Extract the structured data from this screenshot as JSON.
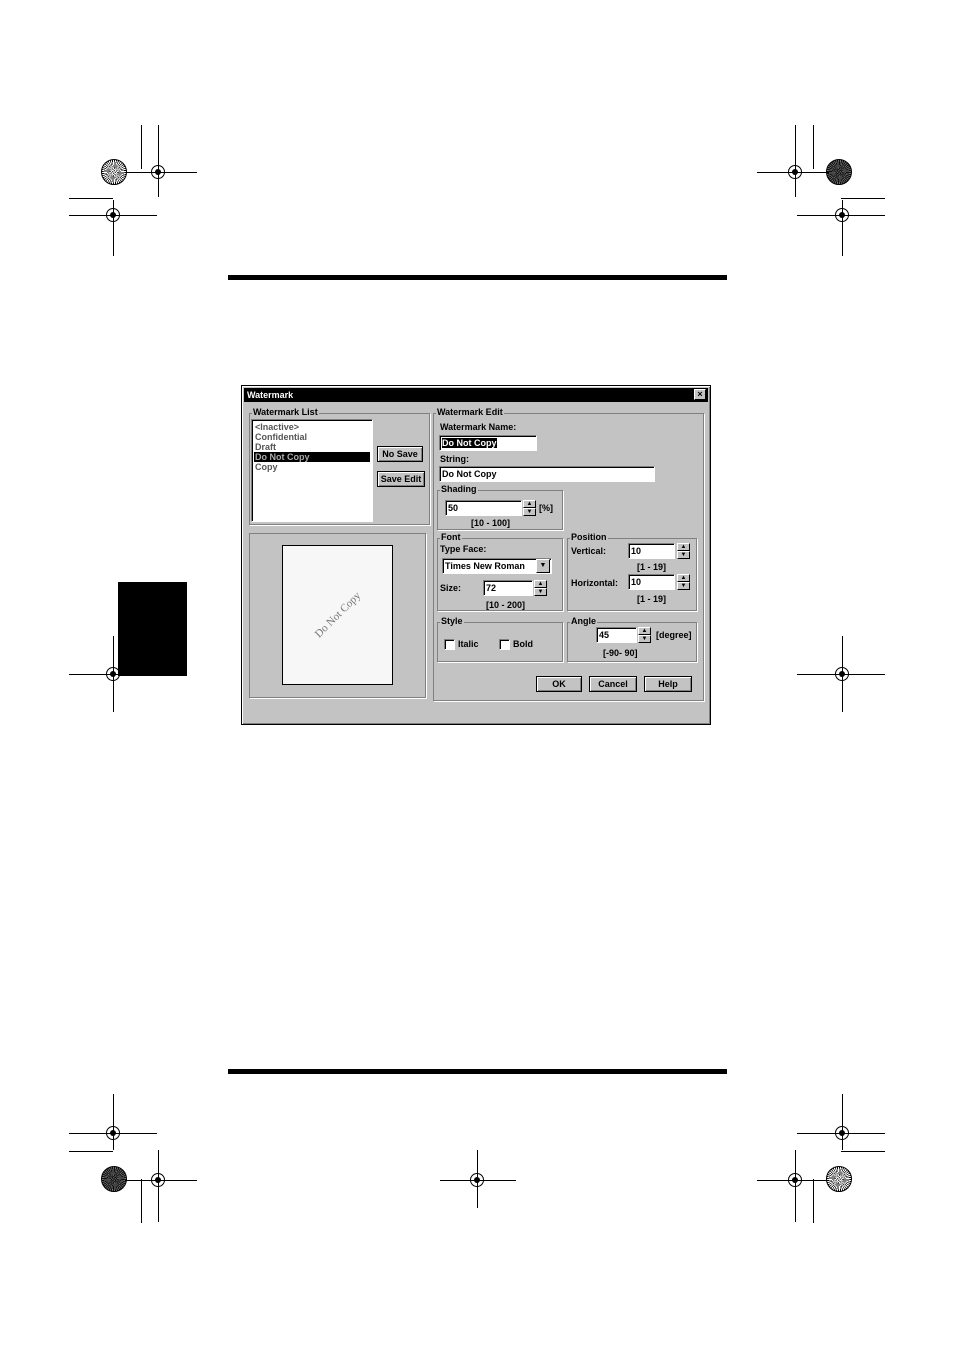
{
  "dialog": {
    "title": "Watermark",
    "close_glyph": "×"
  },
  "watermark_list": {
    "group_label": "Watermark List",
    "items": [
      {
        "label": "<Inactive>"
      },
      {
        "label": "Confidential"
      },
      {
        "label": "Draft"
      },
      {
        "label": "Do Not Copy",
        "selected": true
      },
      {
        "label": "Copy"
      }
    ],
    "no_save_label": "No Save",
    "save_edit_label": "Save Edit"
  },
  "preview": {
    "watermark_text": "Do Not Copy"
  },
  "watermark_edit": {
    "group_label": "Watermark Edit",
    "name_label": "Watermark Name:",
    "name_value": "Do Not Copy",
    "string_label": "String:",
    "string_value": "Do Not Copy"
  },
  "shading": {
    "group_label": "Shading",
    "value": "50",
    "unit": "[%]",
    "range": "[10 - 100]"
  },
  "font": {
    "group_label": "Font",
    "type_face_label": "Type Face:",
    "type_face_value": "Times New Roman",
    "size_label": "Size:",
    "size_value": "72",
    "size_range": "[10 - 200]"
  },
  "position": {
    "group_label": "Position",
    "vertical_label": "Vertical:",
    "vertical_value": "10",
    "vertical_range": "[1 - 19]",
    "horizontal_label": "Horizontal:",
    "horizontal_value": "10",
    "horizontal_range": "[1 - 19]"
  },
  "style": {
    "group_label": "Style",
    "italic_label": "Italic",
    "italic_checked": false,
    "bold_label": "Bold",
    "bold_checked": false
  },
  "angle": {
    "group_label": "Angle",
    "value": "45",
    "unit": "[degree]",
    "range": "[-90- 90]"
  },
  "buttons": {
    "ok_label": "OK",
    "cancel_label": "Cancel",
    "help_label": "Help"
  },
  "icons": {
    "spin_up": "▲",
    "spin_down": "▼",
    "dropdown": "▼"
  },
  "colors": {
    "dialog_face": "#c3c3c3",
    "titlebar": "#000000",
    "selection": "#000000"
  }
}
